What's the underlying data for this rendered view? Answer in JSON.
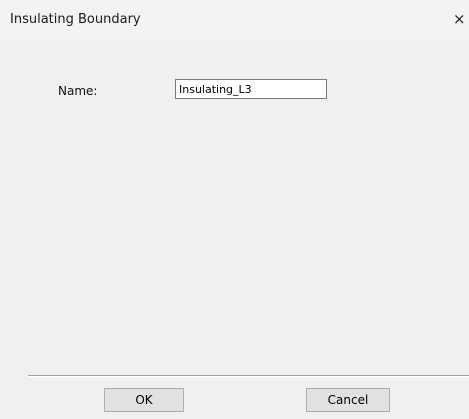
{
  "window": {
    "title": "Insulating Boundary",
    "close_glyph": "×"
  },
  "form": {
    "name_label": "Name:",
    "name_value": "Insulating_L3"
  },
  "buttons": {
    "ok_label": "OK",
    "cancel_label": "Cancel"
  },
  "icons": {
    "close": "close-icon"
  }
}
